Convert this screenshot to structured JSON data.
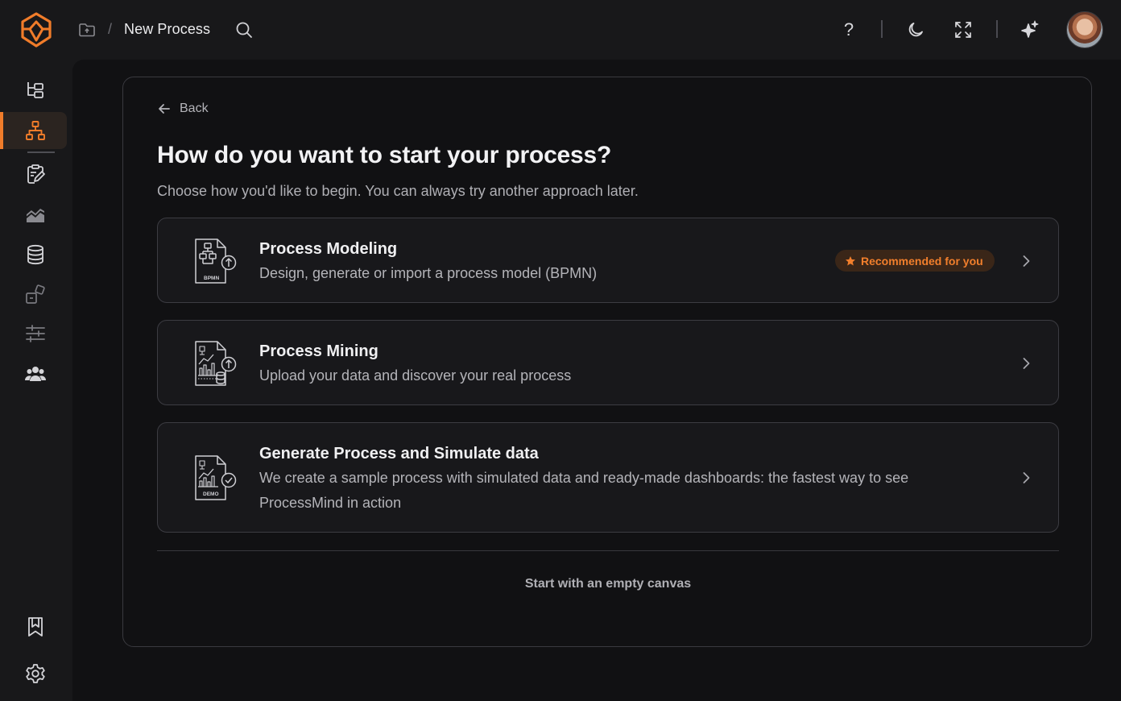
{
  "header": {
    "breadcrumb_separator": "/",
    "title": "New Process",
    "help_label": "?"
  },
  "page": {
    "back_label": "Back",
    "heading": "How do you want to start your process?",
    "subheading": "Choose how you'd like to begin. You can always try another approach later.",
    "options": [
      {
        "title": "Process Modeling",
        "description": "Design, generate or import a process model (BPMN)",
        "icon": "bpmn-file-icon",
        "badge": "Recommended for you",
        "icon_text": "BPMN"
      },
      {
        "title": "Process Mining",
        "description": "Upload your data and discover your real process",
        "icon": "process-mining-file-icon"
      },
      {
        "title": "Generate Process and Simulate data",
        "description": "We create a sample process with simulated data and ready-made dashboards: the fastest way to see ProcessMind in action",
        "icon": "demo-file-icon",
        "icon_text": "DEMO"
      }
    ],
    "empty_canvas_label": "Start with an empty canvas"
  },
  "colors": {
    "accent": "#f07c2a",
    "background": "#111113",
    "card": "#18181b"
  },
  "sidebar": {
    "items": [
      "process-tree-icon",
      "process-model-icon",
      "clipboard-edit-icon",
      "analytics-chart-icon",
      "database-icon",
      "integrations-icon",
      "sliders-icon",
      "users-icon",
      "bookmark-icon",
      "settings-icon"
    ]
  }
}
